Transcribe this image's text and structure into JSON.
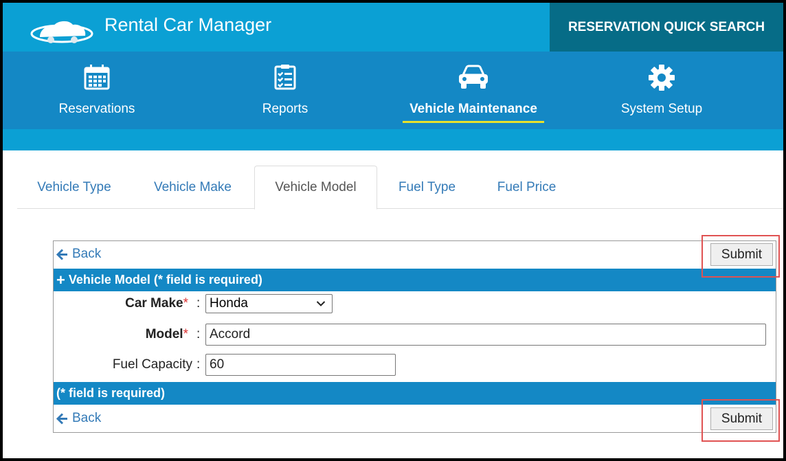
{
  "header": {
    "app_title": "Rental Car Manager",
    "quick_search": "RESERVATION QUICK SEARCH"
  },
  "nav": {
    "items": [
      {
        "label": "Reservations",
        "icon": "calendar-icon",
        "active": false
      },
      {
        "label": "Reports",
        "icon": "checklist-icon",
        "active": false
      },
      {
        "label": "Vehicle Maintenance",
        "icon": "car-icon",
        "active": true
      },
      {
        "label": "System Setup",
        "icon": "gear-icon",
        "active": false
      }
    ]
  },
  "tabs": [
    {
      "label": "Vehicle Type",
      "active": false
    },
    {
      "label": "Vehicle Make",
      "active": false
    },
    {
      "label": "Vehicle Model",
      "active": true
    },
    {
      "label": "Fuel Type",
      "active": false
    },
    {
      "label": "Fuel Price",
      "active": false
    }
  ],
  "form": {
    "back_label": "Back",
    "submit_label": "Submit",
    "section_header": "Vehicle Model (* field is required)",
    "footer_note": "(* field is required)",
    "fields": {
      "car_make": {
        "label": "Car Make",
        "required_mark": "*",
        "value": "Honda"
      },
      "model": {
        "label": "Model",
        "required_mark": "*",
        "value": "Accord"
      },
      "fuel_capacity": {
        "label": "Fuel Capacity",
        "value": "60"
      }
    },
    "colon": ":"
  },
  "colors": {
    "header_bg": "#0ba0d4",
    "quick_search_bg": "#066c87",
    "nav_bg": "#1488c5",
    "active_underline": "#e8e12a",
    "link": "#337ab7",
    "required": "#dd3333",
    "highlight": "#e05252"
  }
}
